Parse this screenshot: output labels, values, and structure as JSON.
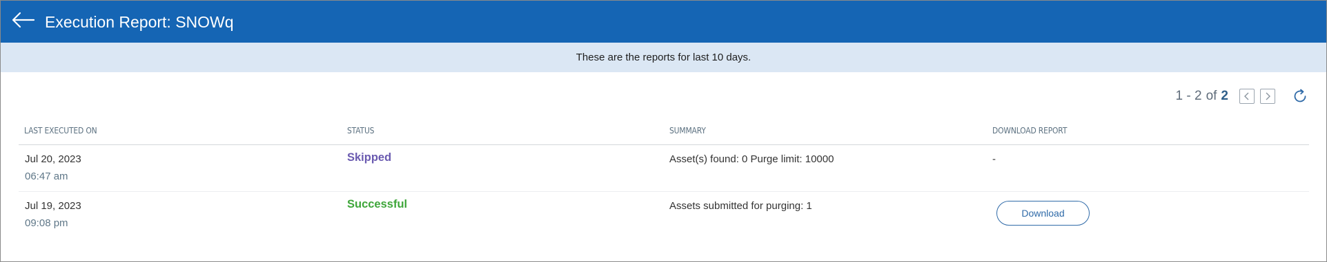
{
  "header": {
    "title": "Execution Report: SNOWq",
    "back_icon": "arrow-left-icon"
  },
  "banner": {
    "text": "These are the reports for last 10 days."
  },
  "pagination": {
    "range": "1 - 2",
    "of": "of",
    "total": "2"
  },
  "table": {
    "columns": [
      "LAST EXECUTED ON",
      "STATUS",
      "SUMMARY",
      "DOWNLOAD REPORT"
    ],
    "rows": [
      {
        "date": "Jul 20, 2023",
        "time": "06:47 am",
        "status": "Skipped",
        "summary": "Asset(s) found: 0 Purge limit: 10000",
        "download": "-"
      },
      {
        "date": "Jul 19, 2023",
        "time": "09:08 pm",
        "status": "Successful",
        "summary": "Assets submitted for purging: 1",
        "download": "Download"
      }
    ]
  },
  "colors": {
    "header": "#1565b4",
    "banner": "#dbe7f4",
    "skipped": "#6a5ab0",
    "successful": "#3ea63a"
  }
}
